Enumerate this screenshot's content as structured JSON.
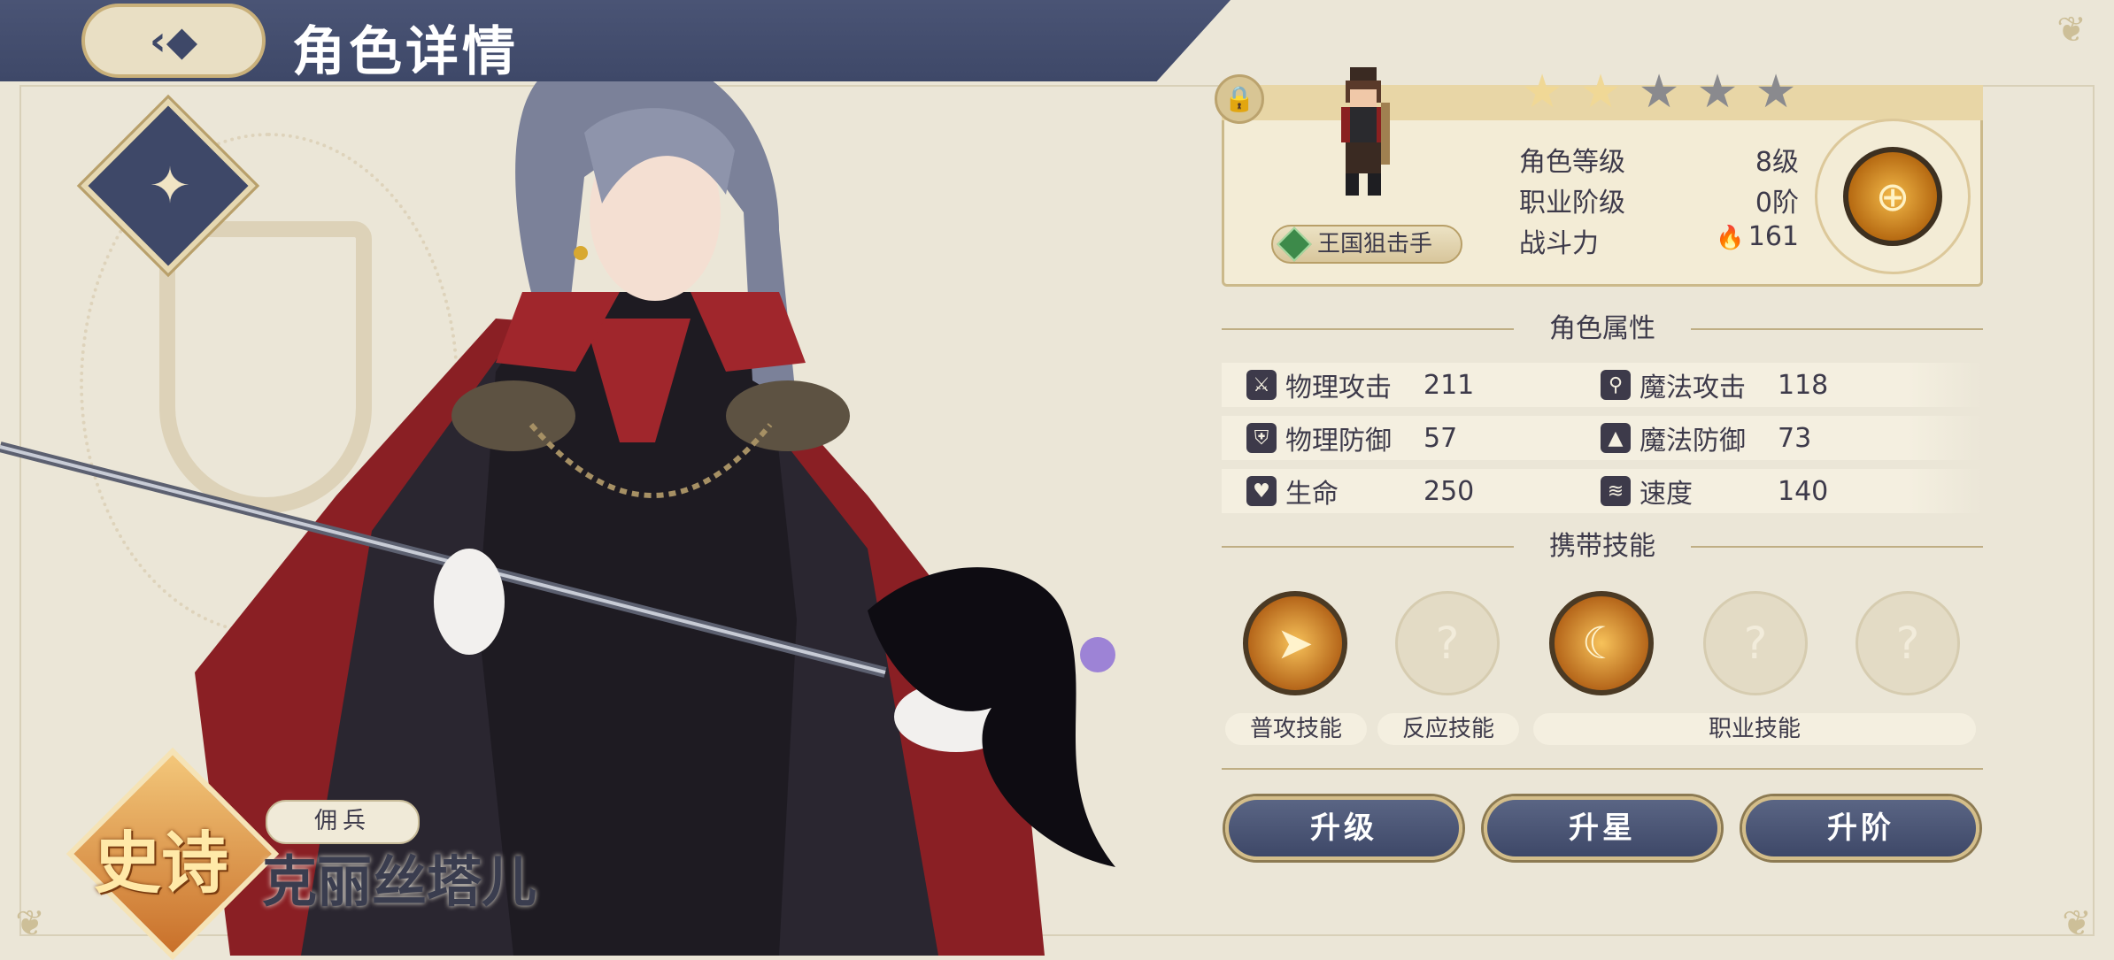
{
  "header": {
    "back_icon": "chevron-left-icon",
    "title": "角色详情"
  },
  "character": {
    "rarity": "史诗",
    "role": "佣兵",
    "name": "克丽丝塔儿",
    "class_icon": "bow-crossbow-icon"
  },
  "info": {
    "stars_filled": 2,
    "stars_total": 5,
    "class_name": "王国狙击手",
    "rows": [
      {
        "label": "角色等级",
        "value": "8级"
      },
      {
        "label": "职业阶级",
        "value": "0阶"
      },
      {
        "label": "战斗力",
        "value": "161"
      }
    ]
  },
  "attributes": {
    "title": "角色属性",
    "items": [
      {
        "label": "物理攻击",
        "value": "211",
        "icon": "sword-icon"
      },
      {
        "label": "魔法攻击",
        "value": "118",
        "icon": "magic-key-icon"
      },
      {
        "label": "物理防御",
        "value": "57",
        "icon": "shield-icon"
      },
      {
        "label": "魔法防御",
        "value": "73",
        "icon": "wizard-hat-icon"
      },
      {
        "label": "生命",
        "value": "250",
        "icon": "heart-icon"
      },
      {
        "label": "速度",
        "value": "140",
        "icon": "wing-icon"
      }
    ]
  },
  "skills": {
    "title": "携带技能",
    "labels": {
      "normal": "普攻技能",
      "reaction": "反应技能",
      "job": "职业技能"
    }
  },
  "actions": {
    "level_up": "升级",
    "star_up": "升星",
    "rank_up": "升阶"
  },
  "colors": {
    "accent_navy": "#3e4868",
    "gold": "#c9a060",
    "background": "#ebe6d7"
  }
}
